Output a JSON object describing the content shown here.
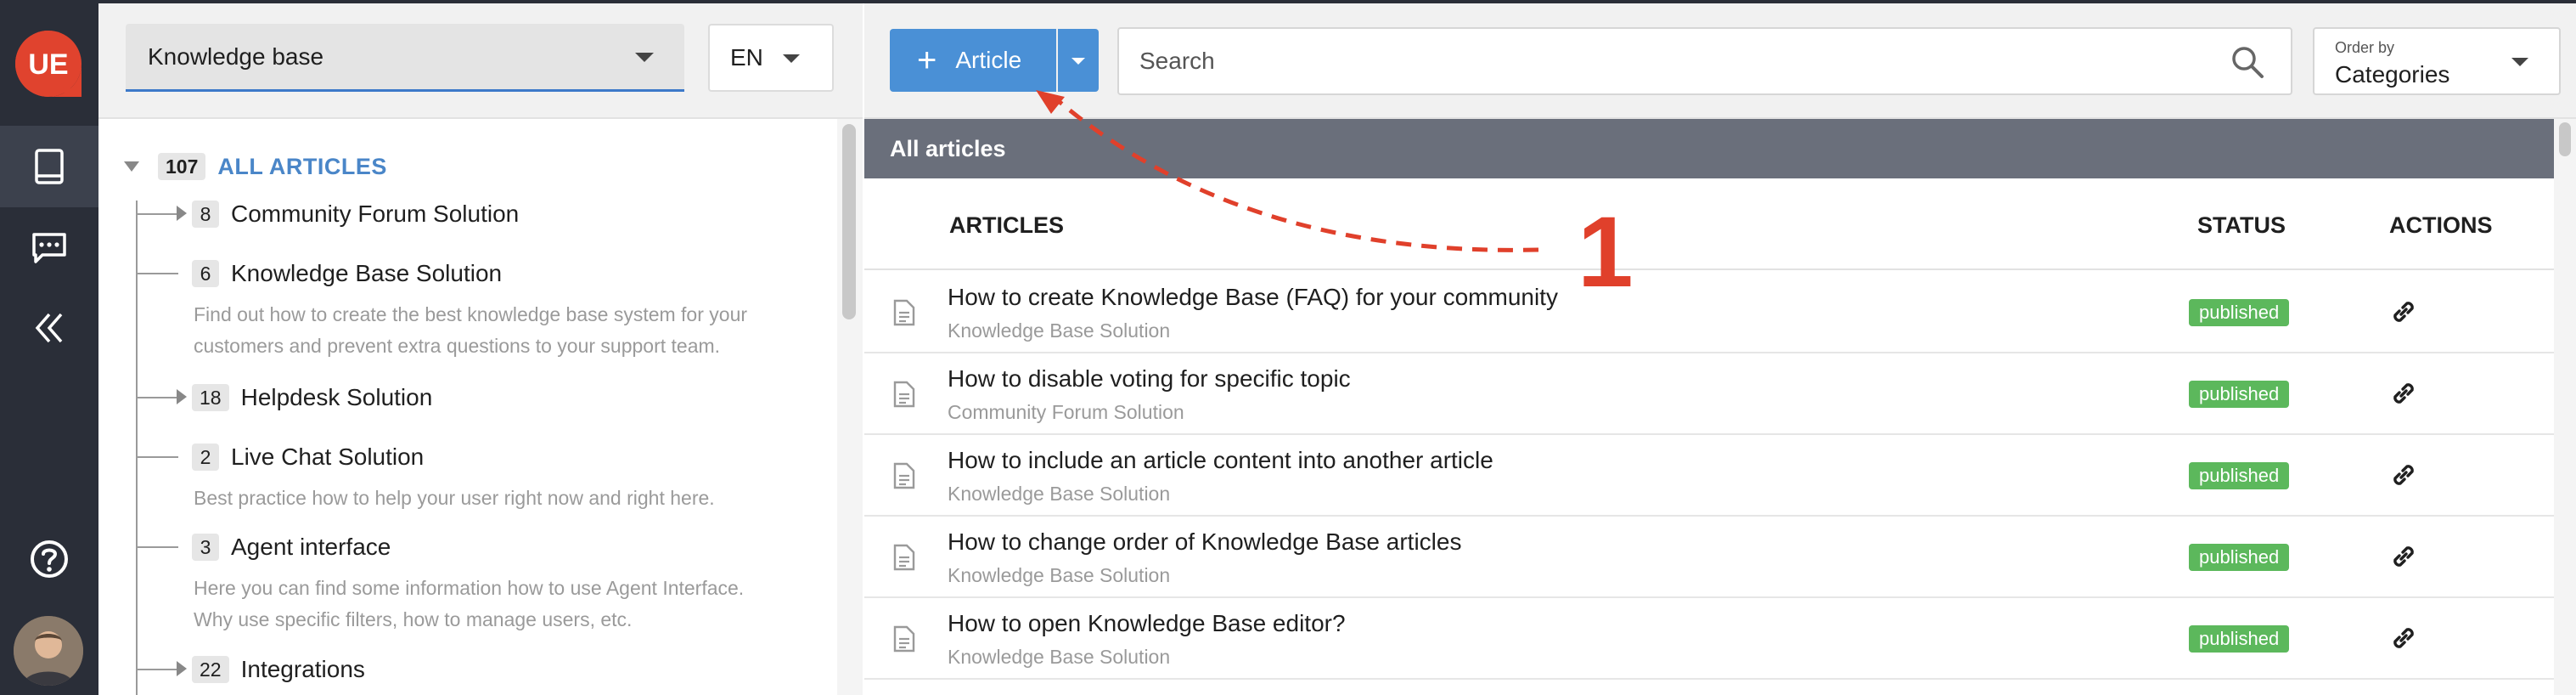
{
  "rail": {
    "logo_text": "UE",
    "colors": {
      "bg": "#2a2e38",
      "logo": "#e0432e"
    }
  },
  "tree_panel": {
    "kb_select_value": "Knowledge base",
    "lang_select_value": "EN",
    "root": {
      "count": "107",
      "label": "ALL ARTICLES"
    },
    "nodes": [
      {
        "count": "8",
        "title": "Community Forum Solution",
        "expandable": true,
        "desc": []
      },
      {
        "count": "6",
        "title": "Knowledge Base Solution",
        "expandable": false,
        "desc": [
          "Find out how to create the best knowledge base system for your",
          "customers and prevent extra questions to your support team."
        ]
      },
      {
        "count": "18",
        "title": "Helpdesk Solution",
        "expandable": true,
        "desc": []
      },
      {
        "count": "2",
        "title": "Live Chat Solution",
        "expandable": false,
        "desc": [
          "Best practice how to help your user right now and right here."
        ]
      },
      {
        "count": "3",
        "title": "Agent interface",
        "expandable": false,
        "desc": [
          "Here you can find some information how to use Agent Interface.",
          "Why use specific filters, how to manage users, etc."
        ]
      },
      {
        "count": "22",
        "title": "Integrations",
        "expandable": true,
        "desc": []
      }
    ]
  },
  "toolbar": {
    "add_article_label": "Article",
    "search_placeholder": "Search",
    "order_small_label": "Order by",
    "order_value": "Categories"
  },
  "list": {
    "section_title": "All articles",
    "headers": {
      "articles": "ARTICLES",
      "status": "STATUS",
      "actions": "ACTIONS"
    },
    "rows": [
      {
        "title": "How to create Knowledge Base (FAQ) for your community",
        "category": "Knowledge Base Solution",
        "status": "published"
      },
      {
        "title": "How to disable voting for specific topic",
        "category": "Community Forum Solution",
        "status": "published"
      },
      {
        "title": "How to include an article content into another article",
        "category": "Knowledge Base Solution",
        "status": "published"
      },
      {
        "title": "How to change order of Knowledge Base articles",
        "category": "Knowledge Base Solution",
        "status": "published"
      },
      {
        "title": "How to open Knowledge Base editor?",
        "category": "Knowledge Base Solution",
        "status": "published"
      }
    ]
  },
  "annotation": {
    "number": "1",
    "color": "#e0402b"
  },
  "colors": {
    "accent": "#4a90d6",
    "published": "#5cb85c",
    "section_bar": "#6a6f7b"
  }
}
